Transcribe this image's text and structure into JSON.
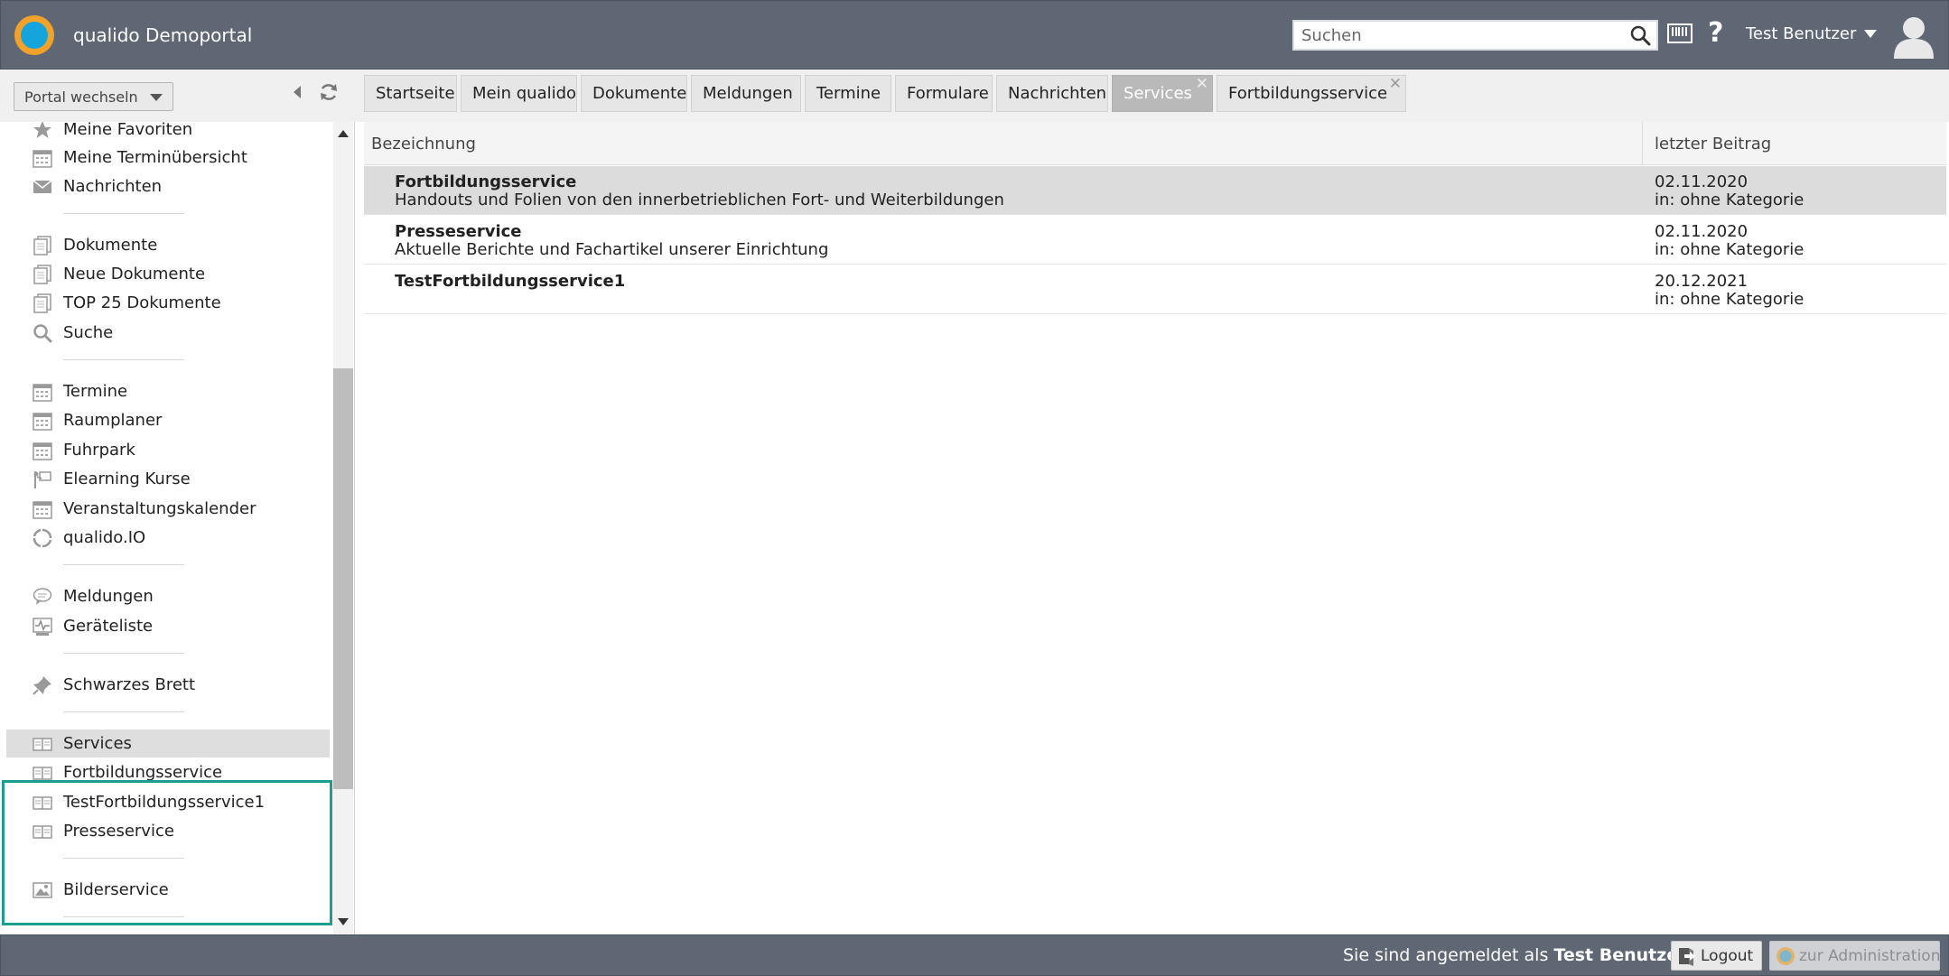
{
  "header": {
    "app_title": "qualido Demoportal",
    "search_placeholder": "Suchen",
    "user_name": "Test Benutzer"
  },
  "sidebar": {
    "portal_switch": "Portal wechseln",
    "items": [
      {
        "label": "Meine Favoriten",
        "icon": "star-icon"
      },
      {
        "label": "Meine Terminübersicht",
        "icon": "calendar-icon"
      },
      {
        "label": "Nachrichten",
        "icon": "envelope-icon"
      },
      {
        "label": "Dokumente",
        "icon": "document-icon"
      },
      {
        "label": "Neue Dokumente",
        "icon": "document-icon"
      },
      {
        "label": "TOP 25 Dokumente",
        "icon": "document-icon"
      },
      {
        "label": "Suche",
        "icon": "search-icon"
      },
      {
        "label": "Termine",
        "icon": "calendar-icon"
      },
      {
        "label": "Raumplaner",
        "icon": "calendar-icon"
      },
      {
        "label": "Fuhrpark",
        "icon": "calendar-icon"
      },
      {
        "label": "Elearning Kurse",
        "icon": "presentation-icon"
      },
      {
        "label": "Veranstaltungskalender",
        "icon": "calendar-icon"
      },
      {
        "label": "qualido.IO",
        "icon": "cycle-icon"
      },
      {
        "label": "Meldungen",
        "icon": "speech-bubble-icon"
      },
      {
        "label": "Geräteliste",
        "icon": "monitor-pulse-icon"
      },
      {
        "label": "Schwarzes Brett",
        "icon": "pushpin-icon"
      },
      {
        "label": "Services",
        "icon": "book-icon"
      },
      {
        "label": "Fortbildungsservice",
        "icon": "book-icon"
      },
      {
        "label": "TestFortbildungsservice1",
        "icon": "book-icon"
      },
      {
        "label": "Presseservice",
        "icon": "book-icon"
      },
      {
        "label": "Bilderservice",
        "icon": "image-icon"
      }
    ]
  },
  "tabs": [
    {
      "label": "Startseite"
    },
    {
      "label": "Mein qualido"
    },
    {
      "label": "Dokumente"
    },
    {
      "label": "Meldungen"
    },
    {
      "label": "Termine"
    },
    {
      "label": "Formulare"
    },
    {
      "label": "Nachrichten"
    },
    {
      "label": "Services",
      "active": true,
      "closable": true
    },
    {
      "label": "Fortbildungsservice",
      "closable": true
    }
  ],
  "table": {
    "columns": [
      "Bezeichnung",
      "letzter Beitrag"
    ],
    "rows": [
      {
        "title": "Fortbildungsservice",
        "description": "Handouts und Folien von den innerbetrieblichen Fort- und Weiterbildungen",
        "date": "02.11.2020",
        "category": "in: ohne Kategorie"
      },
      {
        "title": "Presseservice",
        "description": "Aktuelle Berichte und Fachartikel unserer Einrichtung",
        "date": "02.11.2020",
        "category": "in: ohne Kategorie"
      },
      {
        "title": "TestFortbildungsservice1",
        "description": "",
        "date": "20.12.2021",
        "category": "in: ohne Kategorie"
      }
    ]
  },
  "footer": {
    "logged_in_prefix": "Sie sind angemeldet als",
    "logged_in_user": "Test Benutzer",
    "logout_label": "Logout",
    "admin_label": "zur Administration"
  },
  "colors": {
    "topbar": "#5f6775",
    "highlight": "#1a9e8f",
    "active_tab": "#b9b9b9",
    "selected_row": "#dcdcdc"
  }
}
